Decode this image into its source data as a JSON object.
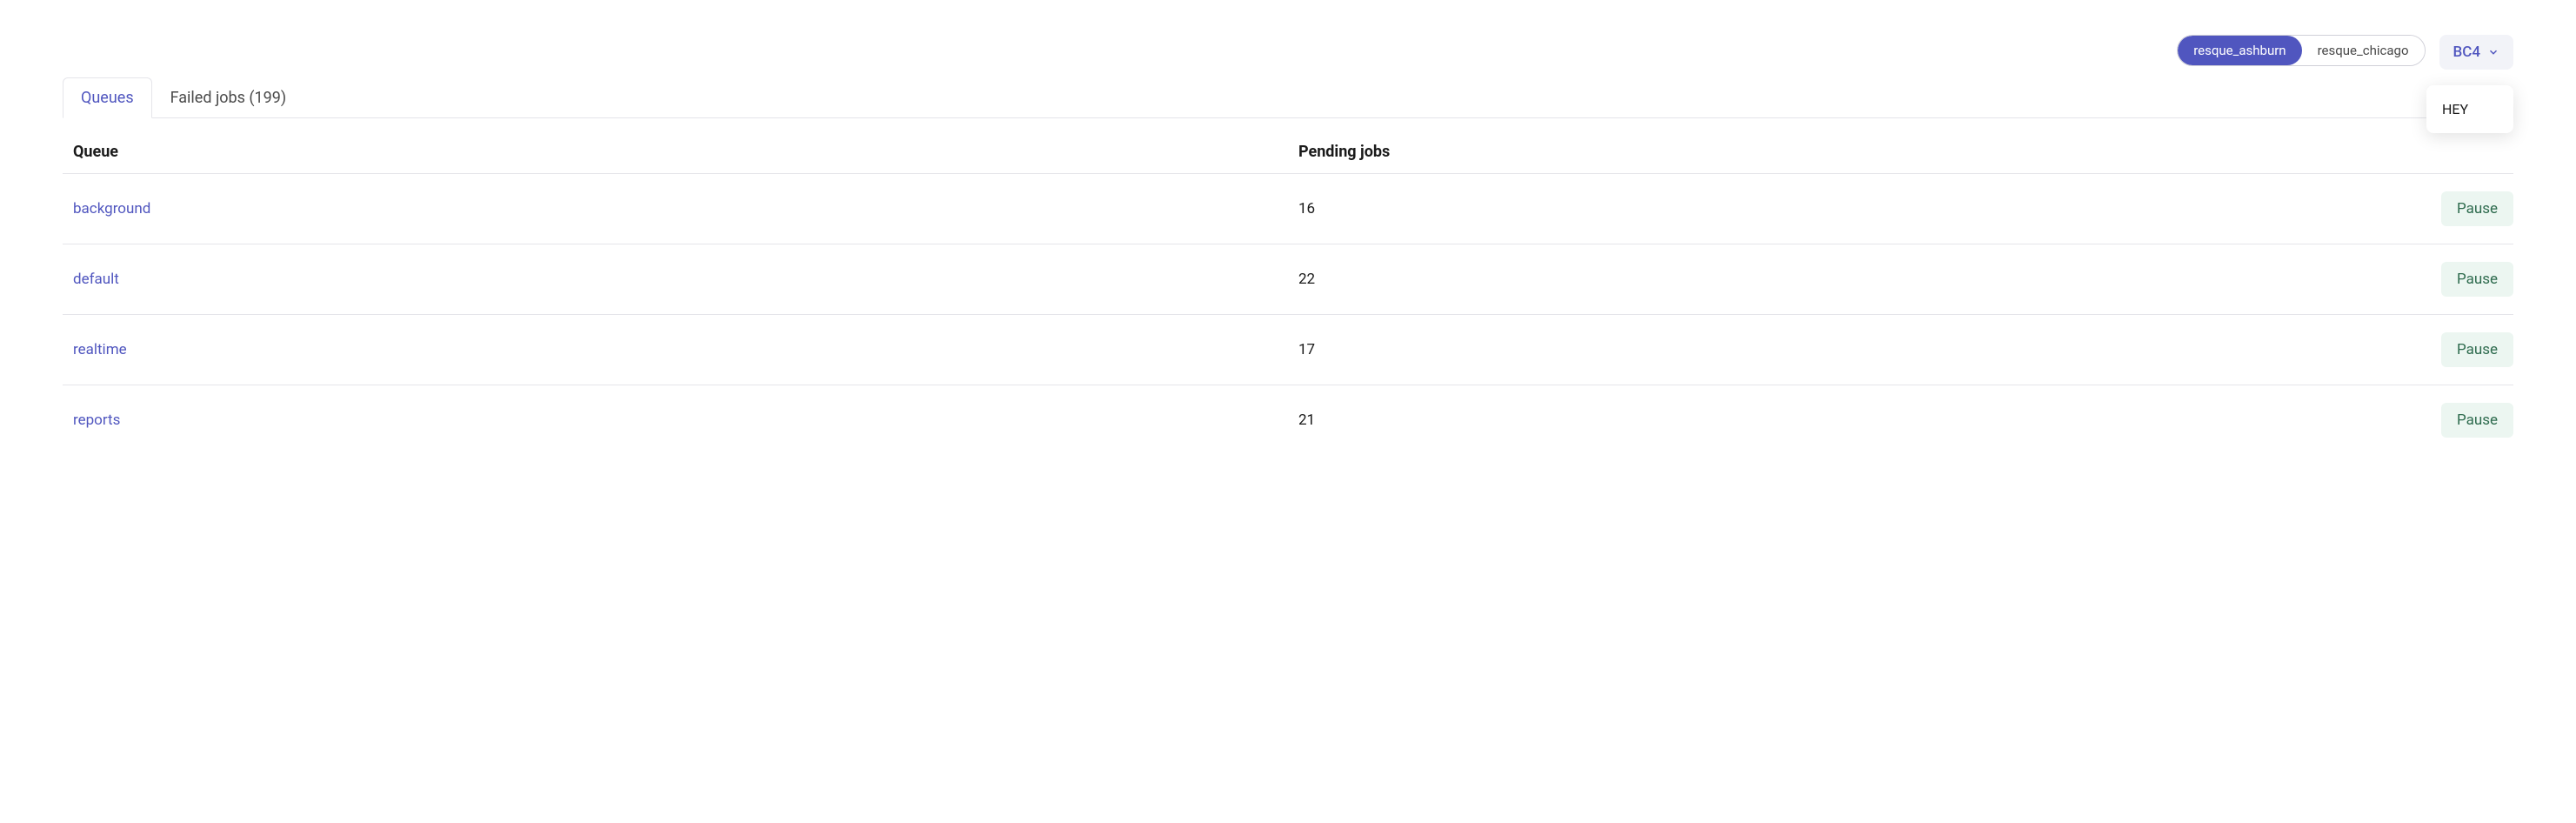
{
  "top": {
    "pills": [
      {
        "label": "resque_ashburn",
        "active": true
      },
      {
        "label": "resque_chicago",
        "active": false
      }
    ],
    "dropdown": {
      "selected": "BC4",
      "menu": [
        {
          "label": "HEY"
        }
      ]
    }
  },
  "tabs": [
    {
      "label": "Queues",
      "active": true
    },
    {
      "label": "Failed jobs (199)",
      "active": false
    }
  ],
  "table": {
    "headers": {
      "queue": "Queue",
      "pending": "Pending jobs"
    },
    "rows": [
      {
        "name": "background",
        "pending": "16",
        "action": "Pause"
      },
      {
        "name": "default",
        "pending": "22",
        "action": "Pause"
      },
      {
        "name": "realtime",
        "pending": "17",
        "action": "Pause"
      },
      {
        "name": "reports",
        "pending": "21",
        "action": "Pause"
      }
    ]
  }
}
